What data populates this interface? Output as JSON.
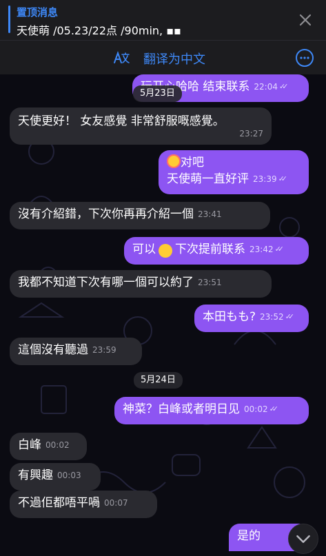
{
  "pinned": {
    "title": "置顶消息",
    "text": "天使萌 /05.23/22点 /90min, ▪▪"
  },
  "translate": {
    "label": "翻译为中文"
  },
  "dates": {
    "d1": "5月23日",
    "d2": "5月24日"
  },
  "messages": [
    {
      "text": "玩开心哈哈 结束联系",
      "time": "22:04",
      "dir": "out"
    },
    {
      "text": "天使更好！ 女友感覺 非常舒服嘅感覺。",
      "time": "23:27",
      "dir": "in"
    },
    {
      "line1": "对吧",
      "line2": "天使萌一直好评",
      "time": "23:39",
      "dir": "out"
    },
    {
      "text": "沒有介紹錯，下次你再再介紹一個",
      "time": "23:41",
      "dir": "in"
    },
    {
      "pre": "可以",
      "post": "下次提前联系",
      "time": "23:42",
      "dir": "out"
    },
    {
      "text": "我都不知道下次有哪一個可以約了",
      "time": "23:51",
      "dir": "in"
    },
    {
      "text": "本田もも?",
      "time": "23:52",
      "dir": "out"
    },
    {
      "text": "這個沒有聽過",
      "time": "23:59",
      "dir": "in"
    },
    {
      "text": "神菜？白峰或者明日见",
      "time": "00:02",
      "dir": "out"
    },
    {
      "text": "白峰",
      "time": "00:02",
      "dir": "in"
    },
    {
      "text": "有興趣",
      "time": "00:03",
      "dir": "in"
    },
    {
      "text": "不過佢都唔平喎",
      "time": "00:07",
      "dir": "in"
    },
    {
      "text": "是的",
      "time": "",
      "dir": "out"
    }
  ],
  "colors": {
    "accent": "#3e88f7",
    "outgoing_bubble": "#8d55f2",
    "incoming_bubble": "#2a2a30",
    "background": "#0b0b12"
  },
  "icons": [
    "close-icon",
    "translate-icon",
    "more-icon",
    "read-checks-icon",
    "emoji-icon",
    "chevron-down-icon"
  ]
}
